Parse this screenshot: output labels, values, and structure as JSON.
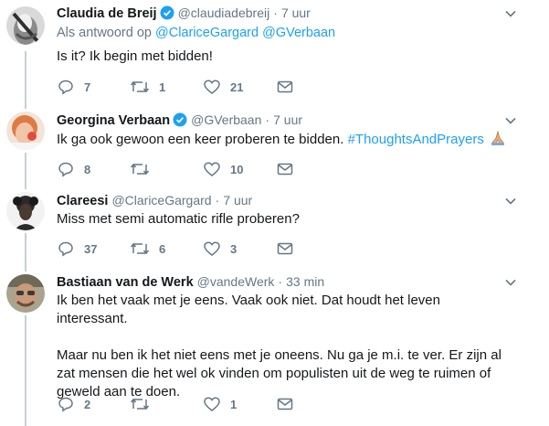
{
  "tweets": [
    {
      "name": "Claudia de Breij",
      "verified": true,
      "handle": "@claudiadebreij",
      "separator": "·",
      "time": "7 uur",
      "reply_prefix": "Als antwoord op",
      "reply_to_1": "@ClariceGargard",
      "reply_to_2": "@GVerbaan",
      "text": "Is it? Ik begin met bidden!",
      "replies": "7",
      "retweets": "1",
      "likes": "21"
    },
    {
      "name": "Georgina Verbaan",
      "verified": true,
      "handle": "@GVerbaan",
      "separator": "·",
      "time": "7 uur",
      "text": "Ik ga ook gewoon een keer proberen te bidden.",
      "hashtag": "#ThoughtsAndPrayers",
      "emoji": "praying-hands-icon",
      "replies": "8",
      "retweets": "",
      "likes": "10"
    },
    {
      "name": "Clareesi",
      "handle": "@ClariceGargard",
      "separator": "·",
      "time": "7 uur",
      "text": "Miss met semi automatic rifle proberen?",
      "replies": "37",
      "retweets": "6",
      "likes": "3"
    },
    {
      "name": "Bastiaan van de Werk",
      "handle": "@vandeWerk",
      "separator": "·",
      "time": "33 min",
      "text_p1": "Ik ben het vaak met je eens. Vaak ook niet. Dat houdt het leven interessant.",
      "text_p2": "Maar nu ben ik het niet eens met je oneens. Nu ga je m.i. te ver. Er zijn al zat mensen die het wel ok vinden om populisten uit de weg te ruimen of geweld aan te doen.",
      "replies": "2",
      "retweets": "",
      "likes": "1"
    }
  ],
  "colors": {
    "link": "#1da1f2",
    "muted": "#657786",
    "text": "#14171a",
    "thread_line": "#c4cfd6"
  }
}
